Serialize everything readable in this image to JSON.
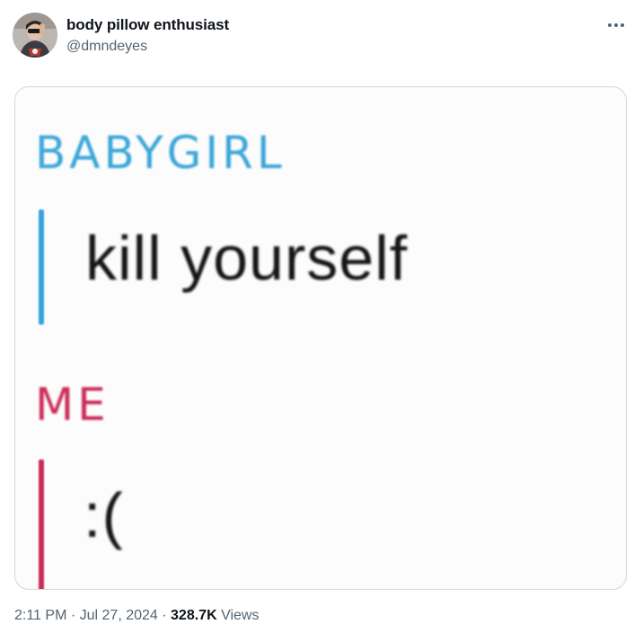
{
  "author": {
    "display_name": "body pillow enthusiast",
    "handle": "@dmndeyes",
    "avatar_icon": "profile-avatar"
  },
  "menu": {
    "icon": "more-horizontal-icon"
  },
  "media": {
    "sender_label": "BABYGIRL",
    "sender_message": "kill yourself",
    "me_label": "ME",
    "me_message": ":(",
    "colors": {
      "babygirl_accent": "#3aa6d8",
      "me_accent": "#cc2c59"
    }
  },
  "meta": {
    "time": "2:11 PM",
    "separator1": " · ",
    "date": "Jul 27, 2024",
    "separator2": " · ",
    "views_count": "328.7K",
    "views_label": "Views"
  }
}
